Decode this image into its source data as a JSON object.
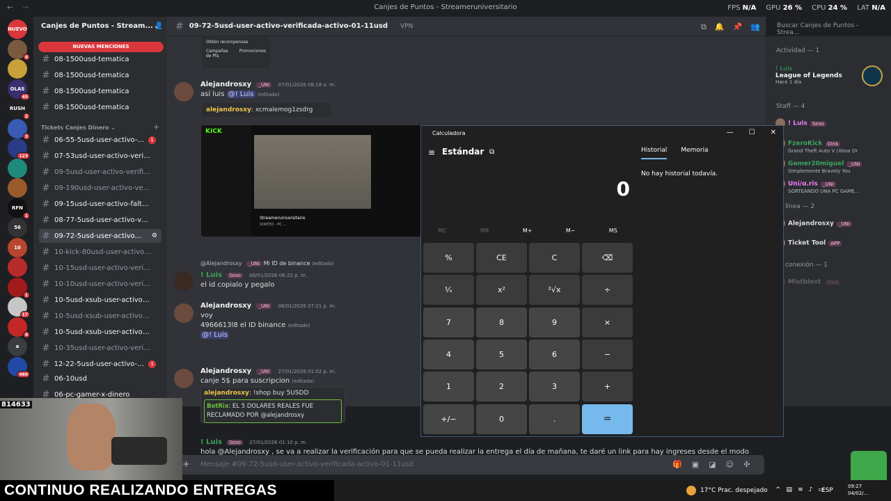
{
  "window": {
    "title": "Canjes de Puntos - Streameruniversitario",
    "stats": [
      {
        "label": "FPS",
        "value": "N/A"
      },
      {
        "label": "GPU",
        "value": "26 %"
      },
      {
        "label": "CPU",
        "value": "24 %"
      },
      {
        "label": "LAT",
        "value": "N/A"
      }
    ]
  },
  "rail": {
    "servers": [
      {
        "label": "NUEVO",
        "badge": "",
        "color": "#da373c"
      },
      {
        "label": "",
        "badge": "4",
        "color": "#7a5a3e"
      },
      {
        "label": "",
        "badge": "",
        "color": "#c9a03a"
      },
      {
        "label": "OLAS",
        "badge": "45",
        "color": "#3a2f6e"
      },
      {
        "label": "RUSH",
        "badge": "2",
        "color": "#222"
      },
      {
        "label": "",
        "badge": "3",
        "color": "#385bb5"
      },
      {
        "label": "",
        "badge": "123",
        "color": "#2a3b88"
      },
      {
        "label": "",
        "badge": "",
        "color": "#1e8a7a"
      },
      {
        "label": "",
        "badge": "",
        "color": "#9a5a2a"
      },
      {
        "label": "RFN",
        "badge": "1",
        "color": "#111"
      },
      {
        "label": "56",
        "badge": "",
        "color": "#333"
      },
      {
        "label": "10",
        "badge": "",
        "color": "#b8452d"
      },
      {
        "label": "",
        "badge": "",
        "color": "#b82b2b"
      },
      {
        "label": "",
        "badge": "1",
        "color": "#a31a1a"
      },
      {
        "label": "",
        "badge": "17",
        "color": "#c6c6c6"
      },
      {
        "label": "",
        "badge": "4",
        "color": "#c32727"
      },
      {
        "label": "a",
        "badge": "",
        "color": "#3a3c42"
      },
      {
        "label": "",
        "badge": "460",
        "color": "#2349a7"
      }
    ]
  },
  "sidebar": {
    "server_name": "Canjes de Puntos - Stream...",
    "new_mentions": "NUEVAS MENCIONES",
    "category_tickets": "Tickets Canjes Dinero",
    "channels": [
      {
        "name": "08-1500usd-tematica",
        "muted": false,
        "count": ""
      },
      {
        "name": "08-1500usd-tematica",
        "muted": false,
        "count": ""
      },
      {
        "name": "08-1500usd-tematica",
        "muted": false,
        "count": ""
      },
      {
        "name": "08-1500usd-tematica",
        "muted": false,
        "count": ""
      },
      {
        "name": "06-55-5usd-user-activo-...",
        "muted": false,
        "count": "1"
      },
      {
        "name": "07-53usd-user-activo-verific...",
        "muted": false,
        "count": ""
      },
      {
        "name": "09-5usd-user-activo-verificado",
        "muted": true,
        "count": ""
      },
      {
        "name": "09-190usd-user-activo-verifi...",
        "muted": true,
        "count": ""
      },
      {
        "name": "09-15usd-user-activo-falta-ss",
        "muted": false,
        "count": ""
      },
      {
        "name": "08-77-5usd-user-activo-verifi...",
        "muted": false,
        "count": ""
      },
      {
        "name": "09-72-5usd-user-activo...",
        "muted": false,
        "count": "",
        "active": true
      },
      {
        "name": "10-kick-80usd-user-activo-id...",
        "muted": true,
        "count": ""
      },
      {
        "name": "10-15usd-user-activo-verifica...",
        "muted": true,
        "count": ""
      },
      {
        "name": "10-10usd-user-activo-verifica...",
        "muted": true,
        "count": ""
      },
      {
        "name": "10-5usd-xsub-user-activo-ve...",
        "muted": false,
        "count": ""
      },
      {
        "name": "10-5usd-xsub-user-activo-ide...",
        "muted": true,
        "count": ""
      },
      {
        "name": "10-5usd-xsub-user-activo-ide...",
        "muted": false,
        "count": ""
      },
      {
        "name": "10-35usd-user-activo-verific...",
        "muted": true,
        "count": ""
      },
      {
        "name": "12-22-5usd-user-activo-v...",
        "muted": false,
        "count": "1"
      },
      {
        "name": "06-10usd",
        "muted": false,
        "count": ""
      },
      {
        "name": "06-pc-gamer-x-dinero",
        "muted": false,
        "count": ""
      }
    ]
  },
  "header": {
    "channel": "09-72-5usd-user-activo-verificada-activo-01-11usd",
    "topic": "VPN",
    "search_placeholder": "Buscar Canjes de Puntos - Strea..."
  },
  "chat": {
    "top_embed": {
      "title": "Obtén recompensas",
      "label1": "Campañas de Pts",
      "label2": "Promociones"
    },
    "messages": [
      {
        "author": "Alejandrosxy",
        "tag": "_UNI",
        "time": "07/01/2026 08:18 a. m.",
        "text": "así luis",
        "mention": "@! Luis",
        "edited": "(editado)"
      },
      {
        "quote_author": "alejandrosxy",
        "quote_text": ": xcmalemog1zsdrg"
      },
      {
        "reply_author": "@Alejandrosxy",
        "reply_tag": "_UNI",
        "reply_text": "Mi ID de binance",
        "reply_edited": "(editado)",
        "author": "! Luis",
        "tag": "Sexo",
        "time": "08/01/2026 06:22 p. m.",
        "text": "el id copialo y pegalo"
      },
      {
        "author": "Alejandrosxy",
        "tag": "_UNI",
        "time": "08/01/2026 07:21 p. m.",
        "text": "voy",
        "text2": "4966613l8 el ID binance",
        "edited": "(editado)",
        "mention": "@! Luis"
      },
      {
        "author": "Alejandrosxy",
        "tag": "_UNI",
        "time": "27/01/2026 01:02 p. m.",
        "text": "canje 5$ para suscripcion",
        "edited": "(editado)",
        "embed_user": "alejandrosxy",
        "embed_cmd": ": !shop buy 5USDD",
        "bot_name": "BotRix",
        "bot_text": ": EL 5 DOLARES REALES FUE RECLAMADO POR @alejandrosxy"
      },
      {
        "author": "! Luis",
        "tag": "Sexo",
        "time": "27/01/2026 01:10 p. m.",
        "text": "hola @Alejandrosxy , se va a realizar la verificación para que se pueda realizar la entrega el día de mañana, te daré un link para hay ingreses desde el modo incognito esto se"
      }
    ],
    "preview": {
      "brand": "KICK",
      "streamer": "Streameruniversitario",
      "title": "SORTEO - PC ..."
    }
  },
  "input_placeholder": "Mensaje #09-72-5usd-user-activo-verificada-activo-01-11usd",
  "right": {
    "activity": "Actividad — 1",
    "activity_user": "! Luis",
    "activity_game": "League of Legends",
    "activity_time": "Hace 1 día",
    "staff": "Staff — 4",
    "staff_members": [
      {
        "name": "! Luis",
        "tag": "Sexo",
        "status": "",
        "color": "#f47fff"
      },
      {
        "name": "FzeroKick",
        "tag": "Oink",
        "status": "Grand Theft Auto V (Xbox Or",
        "color": "#3ba55d"
      },
      {
        "name": "Gamer20miguel",
        "tag": "_UNI",
        "status": "Simplemente Bravely You",
        "color": "#3ba55d"
      },
      {
        "name": "Uni/ɑ.ris",
        "tag": "_UNI",
        "status": "SORTEANDO UNA PC GAME...",
        "color": "#f47fff"
      }
    ],
    "online": "línea — 2",
    "online_members": [
      {
        "name": "Alejandrosxy",
        "tag": "_UNI"
      },
      {
        "name": "Ticket Tool",
        "tag": "APP"
      }
    ],
    "offline": "conexión — 1",
    "offline_members": [
      {
        "name": "Mistblest",
        "tag": "Oink"
      }
    ]
  },
  "calculator": {
    "title": "Calculadora",
    "mode": "Estándar",
    "display": "0",
    "tabs": [
      "Historial",
      "Memoria"
    ],
    "no_history": "No hay historial todavía.",
    "memory": [
      "MC",
      "MR",
      "M+",
      "M−",
      "MS"
    ],
    "keys": [
      "%",
      "CE",
      "C",
      "⌫",
      "¹⁄ₓ",
      "x²",
      "²√x",
      "÷",
      "7",
      "8",
      "9",
      "×",
      "4",
      "5",
      "6",
      "−",
      "1",
      "2",
      "3",
      "+",
      "+/−",
      "0",
      ".",
      "="
    ]
  },
  "overlay": {
    "banner": "CONTINUO REALIZANDO ENTREGAS",
    "viewer_id": "814633"
  },
  "taskbar": {
    "weather": "17°C  Prac. despejado",
    "lang": "ESP",
    "time": "09:27",
    "date": "04/02/..."
  }
}
